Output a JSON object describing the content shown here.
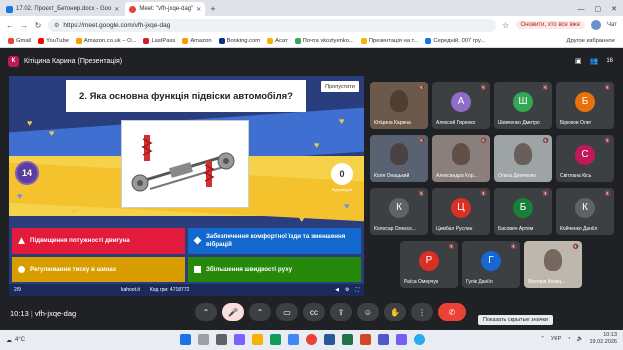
{
  "browser": {
    "tabs": [
      {
        "title": "17.02. Проєкт_Бетонир.docx - Goo",
        "color": "#1a73e8",
        "active": false
      },
      {
        "title": "Meet: \"vfh-jxqe-dag\"",
        "color": "#ea4335",
        "active": true
      }
    ],
    "url": "https://meet.google.com/vfh-jxqe-dag",
    "update_label": "Оновити, хто все вже",
    "chat_label": "Чат",
    "bookmarks": [
      {
        "label": "Gmail",
        "color": "#ea4335"
      },
      {
        "label": "YouTube",
        "color": "#ff0000"
      },
      {
        "label": "Amazon.co.uk – О...",
        "color": "#ff9900"
      },
      {
        "label": "LastPass",
        "color": "#cc2029"
      },
      {
        "label": "Amazon",
        "color": "#ff9900"
      },
      {
        "label": "Booking.com",
        "color": "#003580"
      },
      {
        "label": "Асат",
        "color": "#f4b400"
      },
      {
        "label": "Почта vkozlyenko...",
        "color": "#34a853"
      },
      {
        "label": "Презентація на т...",
        "color": "#f4b400"
      },
      {
        "label": "Середній, 007 гру...",
        "color": "#1a73e8"
      }
    ],
    "other_bookmarks": "Другое избранное"
  },
  "meet": {
    "presenter_title": "Кітіцина Карина (Презентація)",
    "presenter_initial": "К",
    "participant_count": "16",
    "meeting_code": "vfh-jxqe-dag",
    "time": "10:13",
    "tooltip": "Показать скрытые значки"
  },
  "kahoot": {
    "question": "2. Яка основна функція підвіски автомобіля?",
    "skip_label": "Пропустити",
    "timer": "14",
    "answers_count": "0",
    "answers_label": "Відповідей",
    "answers": [
      {
        "text": "Підвищення потужності двигуна",
        "color": "red"
      },
      {
        "text": "Забезпечення комфортної їзди та зменшення вібрацій",
        "color": "blue"
      },
      {
        "text": "Регулювання тиску в шинах",
        "color": "yellow"
      },
      {
        "text": "Збільшення швидкості руху",
        "color": "green"
      }
    ],
    "progress": "2/9",
    "site": "kahoot.it",
    "pin_label": "Код гри: 4718772"
  },
  "participants": [
    {
      "name": "Кітіцина Карина",
      "initial": "",
      "color": "#6b5a4b",
      "video": true
    },
    {
      "name": "Алексей Гиренко",
      "initial": "А",
      "color": "#8e6cc7",
      "video": false
    },
    {
      "name": "Шевченко Дмитро",
      "initial": "Ш",
      "color": "#33a852",
      "video": false
    },
    {
      "name": "Бірюков Олег",
      "initial": "Б",
      "color": "#e8710a",
      "video": false
    },
    {
      "name": "Коля Онацький",
      "initial": "",
      "color": "#586270",
      "video": true
    },
    {
      "name": "Александра Кор...",
      "initial": "",
      "color": "#8a7f7a",
      "video": true
    },
    {
      "name": "Ольга Демченко",
      "initial": "",
      "color": "#9ea3a6",
      "video": true
    },
    {
      "name": "Світлана Кісь",
      "initial": "С",
      "color": "#c2185b",
      "video": false
    },
    {
      "name": "Колосар Олексе...",
      "initial": "К",
      "color": "#5f6368",
      "video": false
    },
    {
      "name": "Цимбал Руслан",
      "initial": "Ц",
      "color": "#d93025",
      "video": false
    },
    {
      "name": "Басович Артем",
      "initial": "Б",
      "color": "#188038",
      "video": false
    },
    {
      "name": "Койченко Даніїл",
      "initial": "К",
      "color": "#5f6368",
      "video": false
    },
    {
      "name": "Раїса Омерчук",
      "initial": "Р",
      "color": "#d93025",
      "video": false
    },
    {
      "name": "Гулік Даніїл",
      "initial": "Г",
      "color": "#1967d2",
      "video": false
    },
    {
      "name": "Вікторія Козиц...",
      "initial": "",
      "color": "#bdb7ae",
      "video": true
    }
  ],
  "taskbar": {
    "weather": "4°C",
    "lang": "УКР",
    "time": "10:13",
    "date": "19.02.2026"
  }
}
